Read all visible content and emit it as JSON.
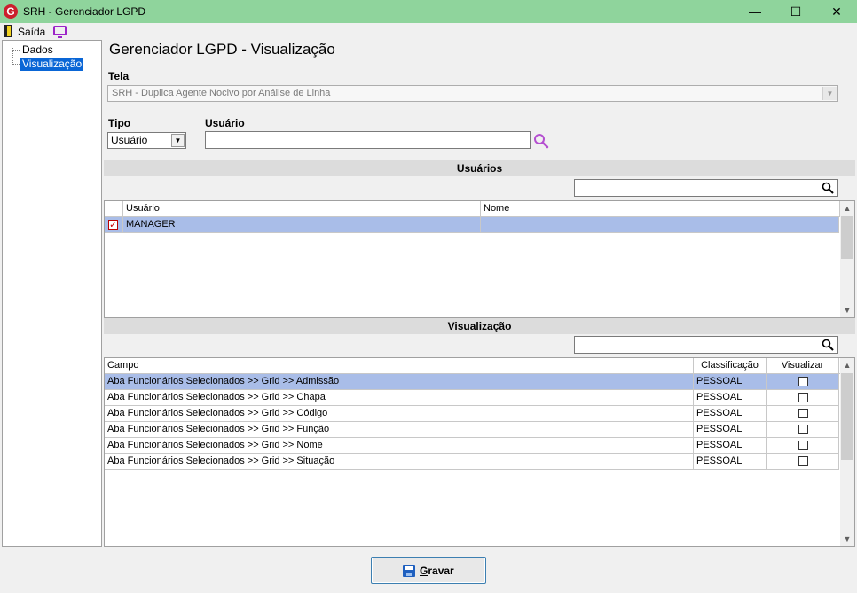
{
  "window": {
    "title": "SRH - Gerenciador LGPD",
    "logo_letter": "G",
    "minimize": "—",
    "maximize": "☐",
    "close": "✕"
  },
  "menu": {
    "exit_label": "Saída"
  },
  "tree": {
    "items": [
      "Dados",
      "Visualização"
    ]
  },
  "page": {
    "title": "Gerenciador LGPD - Visualização"
  },
  "tela": {
    "label": "Tela",
    "value": "SRH - Duplica Agente Nocivo por Análise de Linha"
  },
  "tipo": {
    "label": "Tipo",
    "value": "Usuário"
  },
  "usuario": {
    "label": "Usuário",
    "value": ""
  },
  "users_section": {
    "title": "Usuários",
    "filter": "",
    "columns": [
      "Usuário",
      "Nome"
    ],
    "rows": [
      {
        "checked": true,
        "usuario": "MANAGER",
        "nome": ""
      }
    ]
  },
  "vis_section": {
    "title": "Visualização",
    "filter": "",
    "columns": [
      "Campo",
      "Classificação",
      "Visualizar"
    ],
    "rows": [
      {
        "campo": "Aba Funcionários Selecionados >> Grid >> Admissão",
        "classificacao": "PESSOAL",
        "visualizar": false
      },
      {
        "campo": "Aba Funcionários Selecionados >> Grid >> Chapa",
        "classificacao": "PESSOAL",
        "visualizar": false
      },
      {
        "campo": "Aba Funcionários Selecionados >> Grid >> Código",
        "classificacao": "PESSOAL",
        "visualizar": false
      },
      {
        "campo": "Aba Funcionários Selecionados >> Grid >> Função",
        "classificacao": "PESSOAL",
        "visualizar": false
      },
      {
        "campo": "Aba Funcionários Selecionados >> Grid >> Nome",
        "classificacao": "PESSOAL",
        "visualizar": false
      },
      {
        "campo": "Aba Funcionários Selecionados >> Grid >> Situação",
        "classificacao": "PESSOAL",
        "visualizar": false
      }
    ]
  },
  "actions": {
    "save_label": "Gravar"
  }
}
